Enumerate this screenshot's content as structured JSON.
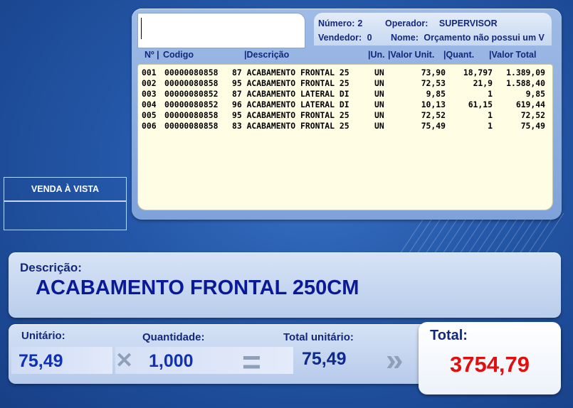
{
  "header": {
    "numero_label": "Número:",
    "numero_value": "2",
    "operador_label": "Operador:",
    "operador_value": "SUPERVISOR",
    "vendedor_label": "Vendedor:",
    "vendedor_value": "0",
    "nome_label": "Nome:",
    "nome_value": "Orçamento não possui um V"
  },
  "code_input": {
    "value": ""
  },
  "columns": {
    "no": "Nº |",
    "codigo": "Codigo",
    "descricao": "|Descrição",
    "un": "|Un.",
    "valor_unit": "|Valor Unit.",
    "quant": "|Quant.",
    "valor_total": "|Valor Total"
  },
  "items": [
    {
      "no": "001",
      "codigo": "00000080858",
      "descricao": "87 ACABAMENTO FRONTAL 25",
      "un": "UN",
      "valor_unit": "73,90",
      "quant": "18,797",
      "valor_total": "1.389,09"
    },
    {
      "no": "002",
      "codigo": "00000080858",
      "descricao": "95 ACABAMENTO FRONTAL 25",
      "un": "UN",
      "valor_unit": "72,53",
      "quant": "21,9",
      "valor_total": "1.588,40"
    },
    {
      "no": "003",
      "codigo": "00000080852",
      "descricao": "87 ACABAMENTO LATERAL DI",
      "un": "UN",
      "valor_unit": "9,85",
      "quant": "1",
      "valor_total": "9,85"
    },
    {
      "no": "004",
      "codigo": "00000080852",
      "descricao": "96 ACABAMENTO LATERAL DI",
      "un": "UN",
      "valor_unit": "10,13",
      "quant": "61,15",
      "valor_total": "619,44"
    },
    {
      "no": "005",
      "codigo": "00000080858",
      "descricao": "95 ACABAMENTO FRONTAL 25",
      "un": "UN",
      "valor_unit": "72,52",
      "quant": "1",
      "valor_total": "72,52"
    },
    {
      "no": "006",
      "codigo": "00000080858",
      "descricao": "83 ACABAMENTO FRONTAL 25",
      "un": "UN",
      "valor_unit": "75,49",
      "quant": "1",
      "valor_total": "75,49"
    }
  ],
  "side": {
    "venda_label": "VENDA À VISTA"
  },
  "description": {
    "label": "Descrição:",
    "value": "ACABAMENTO FRONTAL 250CM"
  },
  "summary": {
    "unitario_label": "Unitário:",
    "unitario_value": "75,49",
    "times_symbol": "✕",
    "quantidade_label": "Quantidade:",
    "quantidade_value": "1,000",
    "equals_symbol": "=",
    "total_unitario_label": "Total unitário:",
    "total_unitario_value": "75,49",
    "arrow_symbol": "»",
    "total_label": "Total:",
    "total_value": "3754,79"
  },
  "colors": {
    "background": "#2457a8",
    "label_blue": "#14287a",
    "value_blue": "#1030b8",
    "total_red": "#e01010",
    "list_bg": "#fffde4"
  }
}
